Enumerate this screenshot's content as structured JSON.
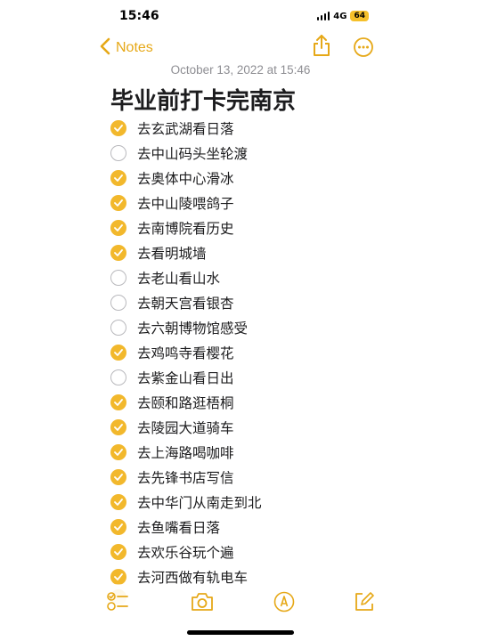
{
  "status_bar": {
    "time": "15:46",
    "network": "4G",
    "battery": "64"
  },
  "nav": {
    "back_label": "Notes",
    "icons": [
      "chevron-left-icon",
      "share-icon",
      "more-icon"
    ]
  },
  "note": {
    "date": "October 13, 2022 at 15:46",
    "title": "毕业前打卡完南京",
    "checklist": [
      {
        "label": "去玄武湖看日落",
        "checked": true
      },
      {
        "label": "去中山码头坐轮渡",
        "checked": false
      },
      {
        "label": "去奥体中心滑冰",
        "checked": true
      },
      {
        "label": "去中山陵喂鸽子",
        "checked": true
      },
      {
        "label": "去南博院看历史",
        "checked": true
      },
      {
        "label": "去看明城墙",
        "checked": true
      },
      {
        "label": "去老山看山水",
        "checked": false
      },
      {
        "label": "去朝天宫看银杏",
        "checked": false
      },
      {
        "label": "去六朝博物馆感受",
        "checked": false
      },
      {
        "label": "去鸡鸣寺看樱花",
        "checked": true
      },
      {
        "label": "去紫金山看日出",
        "checked": false
      },
      {
        "label": "去颐和路逛梧桐",
        "checked": true
      },
      {
        "label": "去陵园大道骑车",
        "checked": true
      },
      {
        "label": "去上海路喝咖啡",
        "checked": true
      },
      {
        "label": "去先锋书店写信",
        "checked": true
      },
      {
        "label": "去中华门从南走到北",
        "checked": true
      },
      {
        "label": "去鱼嘴看日落",
        "checked": true
      },
      {
        "label": "去欢乐谷玩个遍",
        "checked": true
      },
      {
        "label": "去河西做有轨电车",
        "checked": true
      }
    ]
  },
  "toolbar": {
    "icons": [
      "checklist-icon",
      "camera-icon",
      "markup-icon",
      "compose-icon"
    ]
  },
  "colors": {
    "accent": "#f2b82c",
    "accent_text": "#e6a817",
    "date_gray": "#8e8e93",
    "text": "#1c1c1e"
  }
}
